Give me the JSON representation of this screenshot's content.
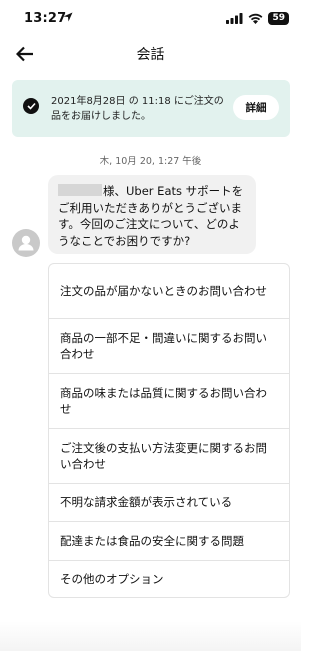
{
  "status_bar": {
    "time": "13:27",
    "battery": "59",
    "icons": [
      "location-arrow-icon",
      "signal-icon",
      "wifi-icon",
      "battery-icon"
    ]
  },
  "nav": {
    "title": "会話",
    "back_icon": "arrow-left-icon"
  },
  "order_banner": {
    "message": "2021年8月28日 の 11:18 にご注文の品をお届けしました。",
    "detail_label": "詳細",
    "icon": "check-circle-icon"
  },
  "timestamp": "木, 10月 20, 1:27 午後",
  "chat": {
    "message": "様、Uber Eats サポートをご利用いただきありがとうございます。今回のご注文について、どのようなことでお困りですか?",
    "avatar_icon": "user-avatar-icon"
  },
  "options": [
    "注文の品が届かないときのお問い合わせ",
    "商品の一部不足・間違いに関するお問い合わせ",
    "商品の味または品質に関するお問い合わせ",
    "ご注文後の支払い方法変更に関するお問い合わせ",
    "不明な請求金額が表示されている",
    "配達または食品の安全に関する問題",
    "その他のオプション"
  ],
  "colors": {
    "banner_bg": "#e2f2ee",
    "bubble_bg": "#f1f1f1",
    "avatar_bg": "#c9c9c9",
    "border": "#e3e3e3"
  }
}
